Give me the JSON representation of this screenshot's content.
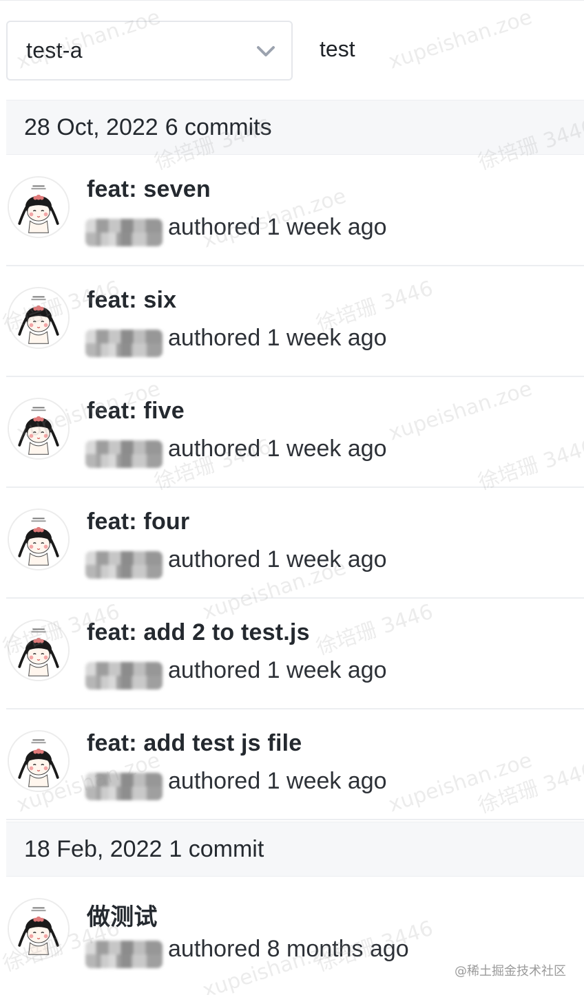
{
  "toolbar": {
    "branch_value": "test-a",
    "path_text": "test"
  },
  "groups": [
    {
      "date": "28 Oct, 2022",
      "count": "6 commits",
      "commits": [
        {
          "title": "feat: seven",
          "meta": "authored 1 week ago"
        },
        {
          "title": "feat: six",
          "meta": "authored 1 week ago"
        },
        {
          "title": "feat: five",
          "meta": "authored 1 week ago"
        },
        {
          "title": "feat: four",
          "meta": "authored 1 week ago"
        },
        {
          "title": "feat: add 2 to test.js",
          "meta": "authored 1 week ago"
        },
        {
          "title": "feat: add test js file",
          "meta": "authored 1 week ago"
        }
      ]
    },
    {
      "date": "18 Feb, 2022",
      "count": "1 commit",
      "commits": [
        {
          "title": "做测试",
          "meta": "authored 8 months ago"
        }
      ]
    }
  ],
  "watermark": {
    "text_a": "xupeishan.zoe",
    "text_b": "徐培珊 3446"
  },
  "site_credit": "@稀土掘金技术社区",
  "icons": {
    "branch_dropdown": "chevron-down-icon",
    "avatar": "cartoon-girl-avatar-icon"
  },
  "colors": {
    "header_bg": "#f6f7f9",
    "border": "#eceef1",
    "text": "#24292f"
  }
}
